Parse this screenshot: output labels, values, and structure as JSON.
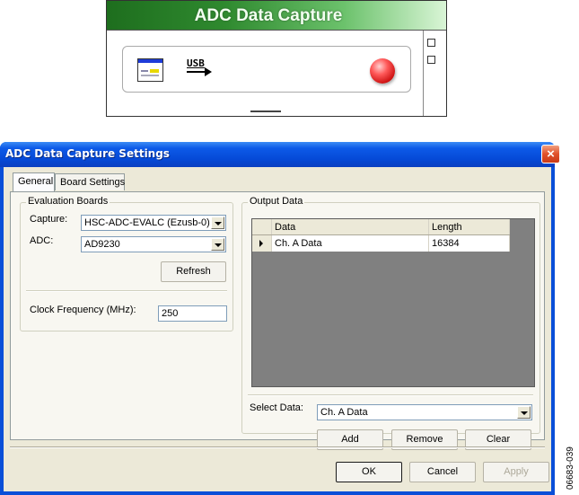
{
  "widget": {
    "title": "ADC Data Capture",
    "icons": [
      "form-icon",
      "usb-arrow-icon",
      "status-led-icon"
    ],
    "usb_label": "USB",
    "status_led_color": "#e02020"
  },
  "dialog": {
    "title": "ADC Data Capture Settings",
    "close_icon": "×",
    "tabs": [
      {
        "label": "General",
        "active": true
      },
      {
        "label": "Board Settings",
        "active": false
      }
    ],
    "evaluation_boards": {
      "legend": "Evaluation Boards",
      "capture_label": "Capture:",
      "capture_value": "HSC-ADC-EVALC (Ezusb-0)",
      "adc_label": "ADC:",
      "adc_value": "AD9230",
      "refresh_label": "Refresh",
      "clock_label": "Clock Frequency (MHz):",
      "clock_value": "250"
    },
    "output_data": {
      "legend": "Output Data",
      "columns": [
        "Data",
        "Length"
      ],
      "rows": [
        {
          "data": "Ch. A Data",
          "length": "16384",
          "selected": true
        }
      ],
      "select_label": "Select Data:",
      "select_value": "Ch. A Data",
      "add_label": "Add",
      "remove_label": "Remove",
      "clear_label": "Clear"
    },
    "ok_label": "OK",
    "cancel_label": "Cancel",
    "apply_label": "Apply"
  },
  "figure_id": "06683-039"
}
